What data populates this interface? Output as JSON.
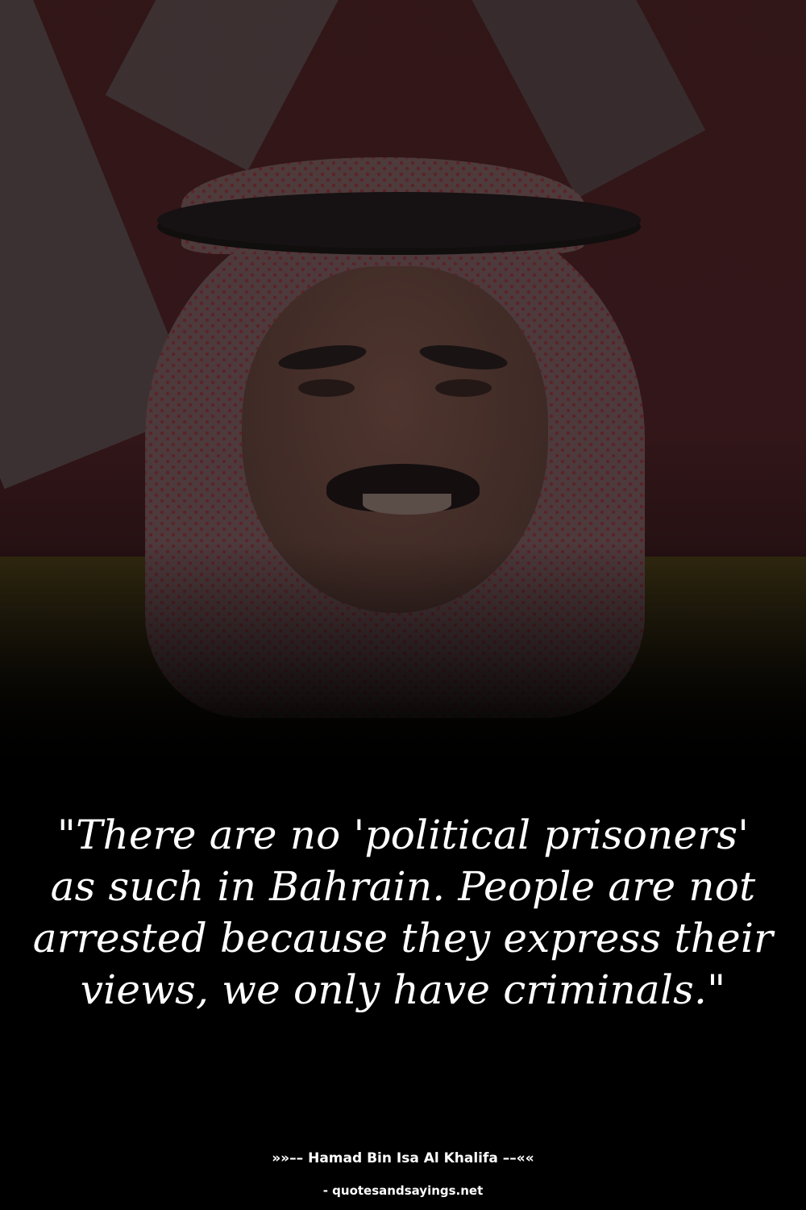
{
  "quote": {
    "text": "\"There are no 'political prisoners' as such in Bahrain. People are not arrested because they express their views, we only have criminals.\""
  },
  "author": {
    "prefix": "»»–– ",
    "name": "Hamad Bin Isa Al Khalifa",
    "suffix": " ––««"
  },
  "source": {
    "text": "- quotesandsayings.net"
  },
  "colors": {
    "background": "#000000",
    "text": "#ffffff"
  }
}
